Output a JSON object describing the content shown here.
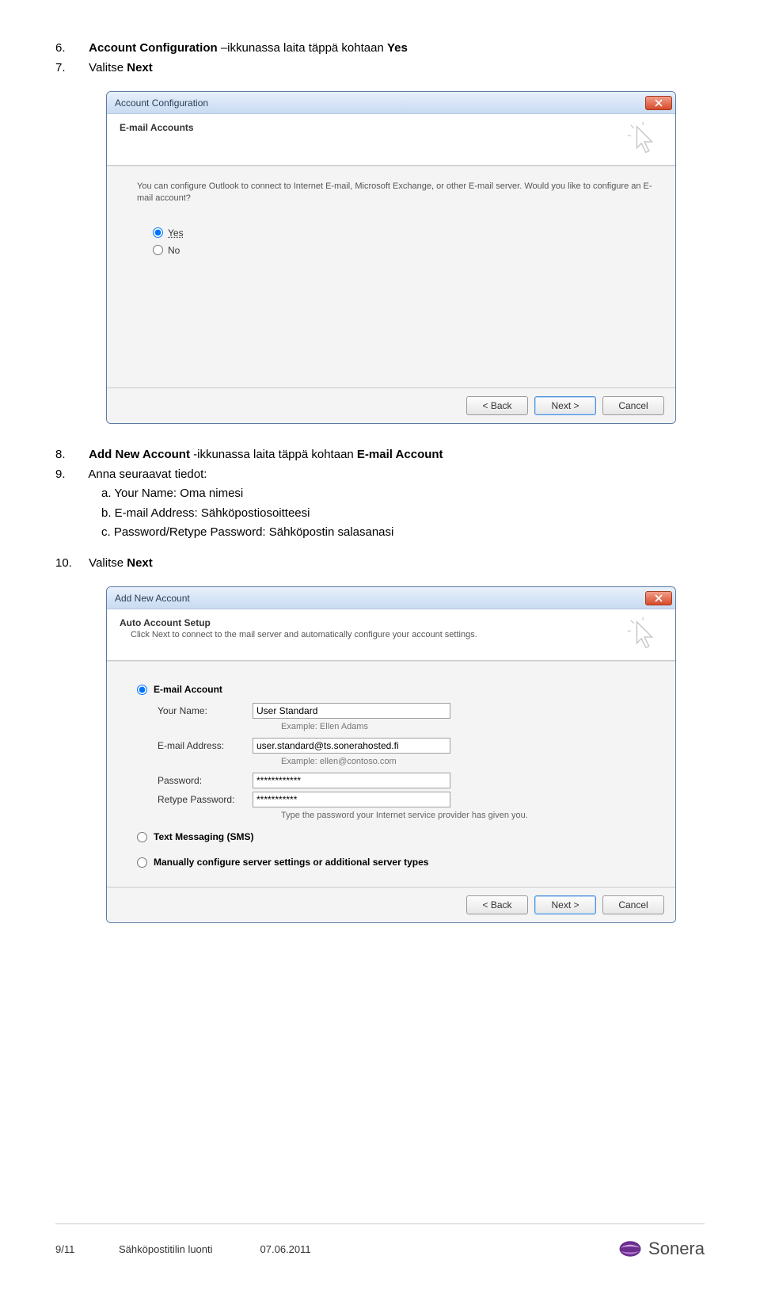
{
  "instructions": {
    "step6_num": "6.",
    "step6_prefix": "Account Configuration",
    "step6_mid": " –ikkunassa laita täppä kohtaan ",
    "step6_bold": "Yes",
    "step7_num": "7.",
    "step7_prefix": "Valitse ",
    "step7_bold": "Next",
    "step8_num": "8.",
    "step8_prefix": "Add New Account",
    "step8_mid": " -ikkunassa laita täppä kohtaan ",
    "step8_bold": "E-mail Account",
    "step9_num": "9.",
    "step9_text": "Anna seuraavat tiedot:",
    "step9a": "a. Your Name: Oma nimesi",
    "step9b": "b. E-mail Address: Sähköpostiosoitteesi",
    "step9c": "c. Password/Retype Password: Sähköpostin salasanasi",
    "step10_num": "10.",
    "step10_prefix": "Valitse ",
    "step10_bold": "Next"
  },
  "dialog1": {
    "title": "Account Configuration",
    "heading": "E-mail Accounts",
    "body": "You can configure Outlook to connect to Internet E-mail, Microsoft Exchange, or other E-mail server. Would you like to configure an E-mail account?",
    "yes": "Yes",
    "no": "No",
    "back": "< Back",
    "next": "Next >",
    "cancel": "Cancel"
  },
  "dialog2": {
    "title": "Add New Account",
    "heading": "Auto Account Setup",
    "sub": "Click Next to connect to the mail server and automatically configure your account settings.",
    "opt_email": "E-mail Account",
    "yourname_label": "Your Name:",
    "yourname_value": "User Standard",
    "yourname_example": "Example: Ellen Adams",
    "email_label": "E-mail Address:",
    "email_value": "user.standard@ts.sonerahosted.fi",
    "email_example": "Example: ellen@contoso.com",
    "password_label": "Password:",
    "password_value": "************",
    "retype_label": "Retype Password:",
    "retype_value": "***********",
    "hint": "Type the password your Internet service provider has given you.",
    "opt_sms": "Text Messaging (SMS)",
    "opt_manual": "Manually configure server settings or additional server types",
    "back": "< Back",
    "next": "Next >",
    "cancel": "Cancel"
  },
  "footer": {
    "left": "9/11",
    "mid": "Sähköpostitilin luonti",
    "date": "07.06.2011",
    "logo_text": "Sonera"
  }
}
